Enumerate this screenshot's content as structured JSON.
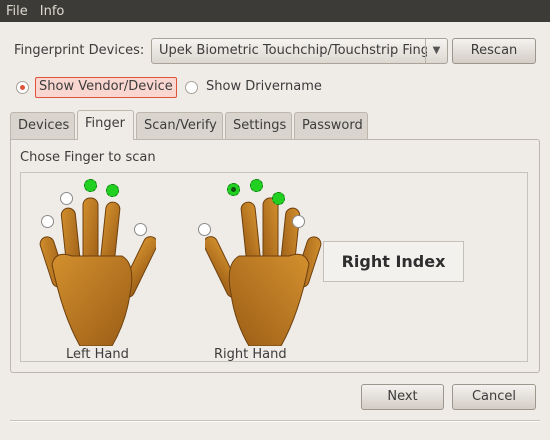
{
  "menu": {
    "file": "File",
    "info": "Info"
  },
  "devices": {
    "label": "Fingerprint Devices:",
    "selected": "Upek Biometric Touchchip/Touchstrip Fing",
    "rescan": "Rescan"
  },
  "radios": {
    "vendor": "Show Vendor/Device",
    "driver": "Show Drivername"
  },
  "tabs": [
    "Devices",
    "Finger",
    "Scan/Verify",
    "Settings",
    "Password"
  ],
  "finger_panel": {
    "prompt": "Chose Finger to scan",
    "left_hand": "Left Hand",
    "right_hand": "Right Hand",
    "selected_finger": "Right Index"
  },
  "buttons": {
    "next": "Next",
    "cancel": "Cancel"
  },
  "colors": {
    "menubar": "#3c3b37",
    "selected_finger": "#22d022",
    "radio_active": "#e0533a"
  }
}
